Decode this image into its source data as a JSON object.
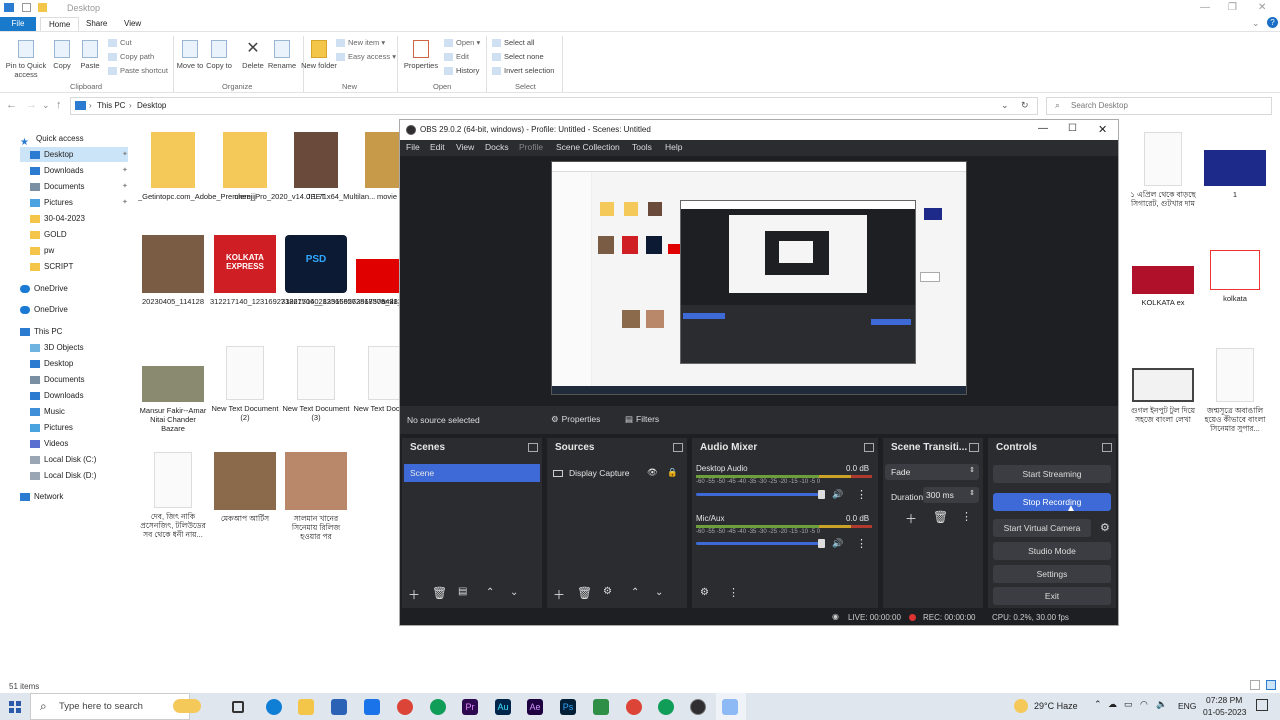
{
  "explorer": {
    "window_title": "Desktop",
    "tabs": {
      "file": "File",
      "home": "Home",
      "share": "Share",
      "view": "View"
    },
    "ribbon": {
      "pin": "Pin to Quick access",
      "copy": "Copy",
      "paste": "Paste",
      "cut": "Cut",
      "copy_path": "Copy path",
      "paste_shortcut": "Paste shortcut",
      "move_to": "Move to",
      "copy_to": "Copy to",
      "delete": "Delete",
      "rename": "Rename",
      "new_folder": "New folder",
      "new_item": "New item",
      "easy_access": "Easy access",
      "properties": "Properties",
      "open": "Open",
      "edit": "Edit",
      "history": "History",
      "select_all": "Select all",
      "select_none": "Select none",
      "invert_selection": "Invert selection",
      "groups": {
        "clipboard": "Clipboard",
        "organize": "Organize",
        "new": "New",
        "open": "Open",
        "select": "Select"
      }
    },
    "breadcrumb": [
      "This PC",
      "Desktop"
    ],
    "search_placeholder": "Search Desktop",
    "nav": {
      "quick_access": "Quick access",
      "quick_items": [
        "Desktop",
        "Downloads",
        "Documents",
        "Pictures",
        "30-04-2023",
        "GOLD",
        "pw",
        "SCRIPT"
      ],
      "onedrive1": "OneDrive",
      "onedrive2": "OneDrive",
      "this_pc": "This PC",
      "pc_items": [
        "3D Objects",
        "Desktop",
        "Documents",
        "Downloads",
        "Music",
        "Pictures",
        "Videos",
        "Local Disk (C:)",
        "Local Disk (D:)"
      ],
      "network": "Network"
    },
    "files": [
      "_Getintopc.com_Adobe_Premiere_Pro_2020_v14.0.1.71x64_Multilan...",
      "chenjij",
      "JEET",
      "movie",
      "20230405_114128",
      "312217140_123169273867506_2835656562518379431_n",
      "312217140_123169273867506_2835656562518379431_n",
      "ami",
      "Mansur Fakir--Amar Nitai Chander Bazare",
      "New Text Document (2)",
      "New Text Document (3)",
      "New Text Document",
      "দেব, জিৎ নাকি প্রসেনজিৎ, টলিউডের সব থেকে ধনী নায়...",
      "মেকআপ আর্টিস",
      "সালমান খানের সিনেমায় রিলিজ হওয়ার পর"
    ],
    "files_right": [
      "১ এপ্রিল থেকে বাড়ছে সিগারেট, গুটখার দাম",
      "1",
      "KOLKATA ex",
      "kolkata",
      "গুগল ইনপুট টুল দিয়ে সহজে বাংলা লেখা",
      "জন্মসূত্রে অবাঙালি হয়েও কীভাবে বাংলা সিনেমার সুপার..."
    ],
    "thumb_text": {
      "kolkata_express": "KOLKATA EXPRESS",
      "psd": "PSD"
    },
    "status": "51 items"
  },
  "obs": {
    "title": "OBS 29.0.2 (64-bit, windows) - Profile: Untitled - Scenes: Untitled",
    "menu": [
      "File",
      "Edit",
      "View",
      "Docks",
      "Profile",
      "Scene Collection",
      "Tools",
      "Help"
    ],
    "no_source": "No source selected",
    "properties": "Properties",
    "filters": "Filters",
    "scenes": {
      "title": "Scenes",
      "items": [
        "Scene"
      ]
    },
    "sources": {
      "title": "Sources",
      "items": [
        "Display Capture"
      ]
    },
    "mixer": {
      "title": "Audio Mixer",
      "channels": [
        {
          "name": "Desktop Audio",
          "db": "0.0 dB"
        },
        {
          "name": "Mic/Aux",
          "db": "0.0 dB"
        }
      ],
      "scale": "-60 -55 -50 -45 -40 -35 -30 -25 -20 -15 -10 -5 0"
    },
    "transitions": {
      "title": "Scene Transiti...",
      "type": "Fade",
      "duration_label": "Duration",
      "duration": "300 ms"
    },
    "controls": {
      "title": "Controls",
      "start_streaming": "Start Streaming",
      "stop_recording": "Stop Recording",
      "start_virtual_camera": "Start Virtual Camera",
      "studio_mode": "Studio Mode",
      "settings": "Settings",
      "exit": "Exit"
    },
    "status": {
      "live": "LIVE: 00:00:00",
      "rec": "REC: 00:00:00",
      "cpu": "CPU: 0.2%, 30.00 fps"
    },
    "accent": "#3d6ad6"
  },
  "taskbar": {
    "search_placeholder": "Type here to search",
    "weather": "29°C Haze",
    "lang": "ENG",
    "time": "07:28 PM",
    "date": "01-05-2023"
  }
}
